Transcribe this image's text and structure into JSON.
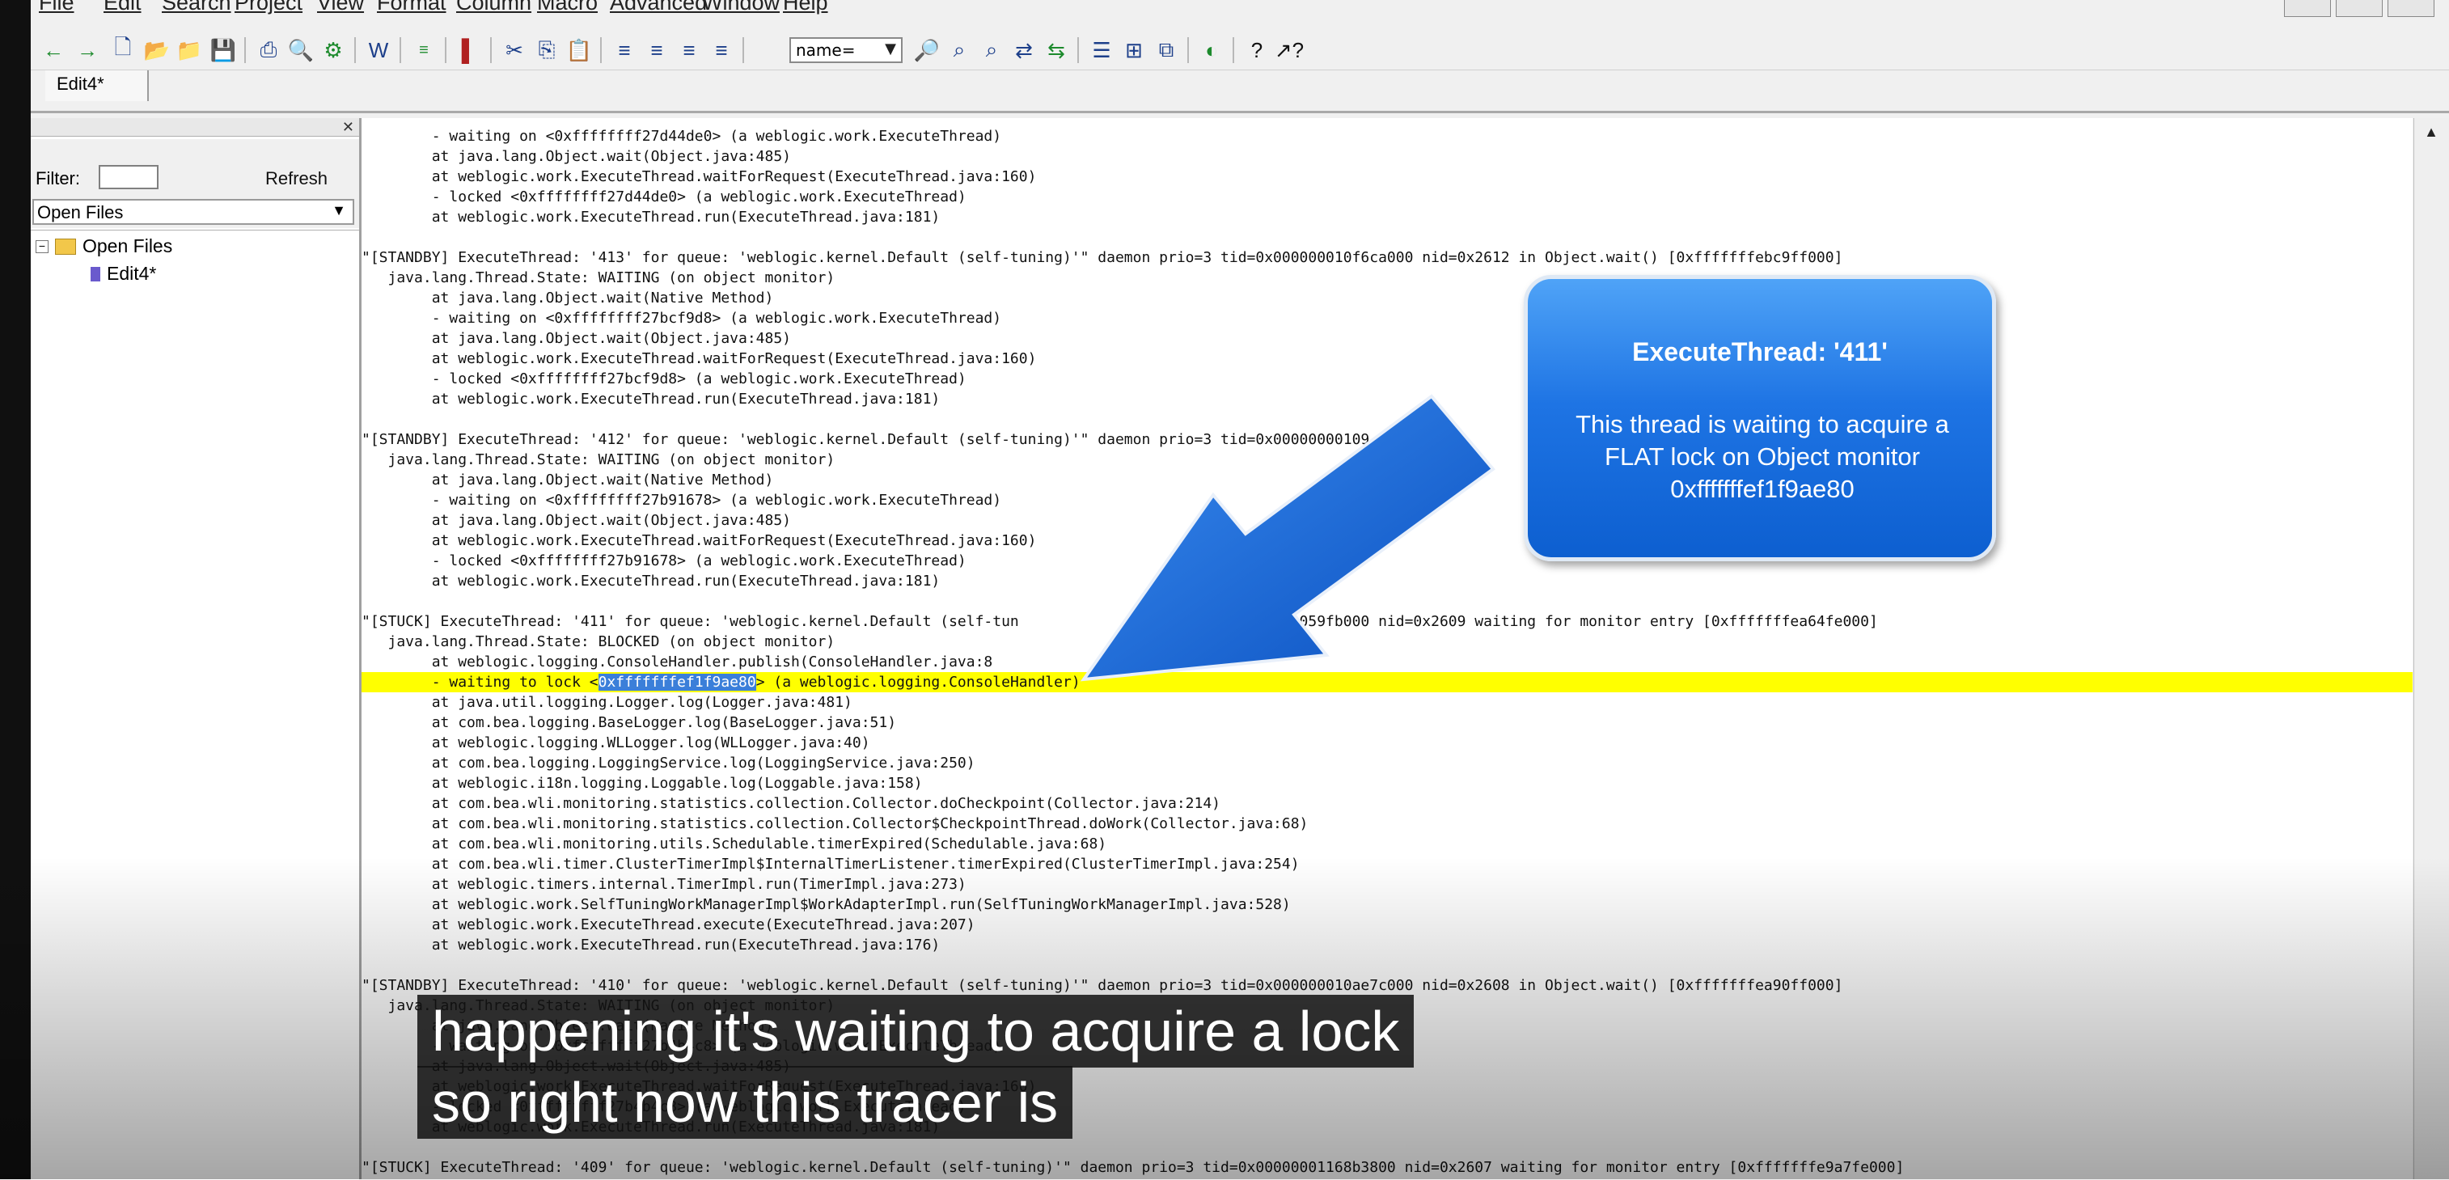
{
  "menu": {
    "items": [
      "File",
      "Edit",
      "Search",
      "Project",
      "View",
      "Format",
      "Column",
      "Macro",
      "Advanced",
      "Window",
      "Help"
    ]
  },
  "toolbar": {
    "find_select_value": "name="
  },
  "tabs": [
    {
      "label": "Edit4*"
    }
  ],
  "panel": {
    "filter_label": "Filter:",
    "refresh_label": "Refresh",
    "source_select_value": "Open Files",
    "tree": {
      "root_label": "Open Files",
      "child_label": "Edit4*"
    }
  },
  "editor": {
    "lines": [
      "        - waiting on <0xffffffff27d44de0> (a weblogic.work.ExecuteThread)",
      "        at java.lang.Object.wait(Object.java:485)",
      "        at weblogic.work.ExecuteThread.waitForRequest(ExecuteThread.java:160)",
      "        - locked <0xffffffff27d44de0> (a weblogic.work.ExecuteThread)",
      "        at weblogic.work.ExecuteThread.run(ExecuteThread.java:181)",
      "",
      "\"[STANDBY] ExecuteThread: '413' for queue: 'weblogic.kernel.Default (self-tuning)'\" daemon prio=3 tid=0x000000010f6ca000 nid=0x2612 in Object.wait() [0xfffffffebc9ff000]",
      "   java.lang.Thread.State: WAITING (on object monitor)",
      "        at java.lang.Object.wait(Native Method)",
      "        - waiting on <0xffffffff27bcf9d8> (a weblogic.work.ExecuteThread)",
      "        at java.lang.Object.wait(Object.java:485)",
      "        at weblogic.work.ExecuteThread.waitForRequest(ExecuteThread.java:160)",
      "        - locked <0xffffffff27bcf9d8> (a weblogic.work.ExecuteThread)",
      "        at weblogic.work.ExecuteThread.run(ExecuteThread.java:181)",
      "",
      "\"[STANDBY] ExecuteThread: '412' for queue: 'weblogic.kernel.Default (self-tuning)'\" daemon prio=3 tid=0x00000000109                                                      eff000]",
      "   java.lang.Thread.State: WAITING (on object monitor)",
      "        at java.lang.Object.wait(Native Method)",
      "        - waiting on <0xffffffff27b91678> (a weblogic.work.ExecuteThread)",
      "        at java.lang.Object.wait(Object.java:485)",
      "        at weblogic.work.ExecuteThread.waitForRequest(ExecuteThread.java:160)",
      "        - locked <0xffffffff27b91678> (a weblogic.work.ExecuteThread)",
      "        at weblogic.work.ExecuteThread.run(ExecuteThread.java:181)",
      "",
      "\"[STUCK] ExecuteThread: '411' for queue: 'weblogic.kernel.Default (self-tun              o=3 tid=0x00000001059fb000 nid=0x2609 waiting for monitor entry [0xfffffffea64fe000]",
      "   java.lang.Thread.State: BLOCKED (on object monitor)",
      "        at weblogic.logging.ConsoleHandler.publish(ConsoleHandler.java:8",
      "__HL__",
      "        at java.util.logging.Logger.log(Logger.java:481)",
      "        at com.bea.logging.BaseLogger.log(BaseLogger.java:51)",
      "        at weblogic.logging.WLLogger.log(WLLogger.java:40)",
      "        at com.bea.logging.LoggingService.log(LoggingService.java:250)",
      "        at weblogic.i18n.logging.Loggable.log(Loggable.java:158)",
      "        at com.bea.wli.monitoring.statistics.collection.Collector.doCheckpoint(Collector.java:214)",
      "        at com.bea.wli.monitoring.statistics.collection.Collector$CheckpointThread.doWork(Collector.java:68)",
      "        at com.bea.wli.monitoring.utils.Schedulable.timerExpired(Schedulable.java:68)",
      "        at com.bea.wli.timer.ClusterTimerImpl$InternalTimerListener.timerExpired(ClusterTimerImpl.java:254)",
      "        at weblogic.timers.internal.TimerImpl.run(TimerImpl.java:273)",
      "        at weblogic.work.SelfTuningWorkManagerImpl$WorkAdapterImpl.run(SelfTuningWorkManagerImpl.java:528)",
      "        at weblogic.work.ExecuteThread.execute(ExecuteThread.java:207)",
      "        at weblogic.work.ExecuteThread.run(ExecuteThread.java:176)",
      "",
      "\"[STANDBY] ExecuteThread: '410' for queue: 'weblogic.kernel.Default (self-tuning)'\" daemon prio=3 tid=0x000000010ae7c000 nid=0x2608 in Object.wait() [0xfffffffea90ff000]",
      "   java.lang.Thread.State: WAITING (on object monitor)",
      "        at java.lang.Object.wait(Native Method)",
      "        - waiting on <0xffffffff27b4b4c8> (a weblogic.work.ExecuteThread)",
      "        at java.lang.Object.wait(Object.java:485)",
      "        at weblogic.work.ExecuteThread.waitForRequest(ExecuteThread.java:160)",
      "        - locked <0xffffffff27b4b4c8> (a weblogic.work.ExecuteThread)",
      "        at weblogic.work.ExecuteThread.run(ExecuteThread.java:181)",
      "",
      "\"[STUCK] ExecuteThread: '409' for queue: 'weblogic.kernel.Default (self-tuning)'\" daemon prio=3 tid=0x00000001168b3800 nid=0x2607 waiting for monitor entry [0xfffffffe9a7fe000]"
    ],
    "highlighted": {
      "prefix": "        - waiting to lock <",
      "selected": "0xfffffffef1f9ae80",
      "suffix": "> (a weblogic.logging.ConsoleHandler)"
    }
  },
  "callout": {
    "title": "ExecuteThread: '411'",
    "body": "This thread is waiting to acquire a FLAT lock on Object monitor 0xfffffffef1f9ae80"
  },
  "captions": [
    "happening it's waiting to acquire a lock",
    "so right now this tracer is"
  ],
  "colors": {
    "highlight": "#ffff00",
    "selection": "#3b7fd9",
    "callout": "#1e74e4"
  }
}
